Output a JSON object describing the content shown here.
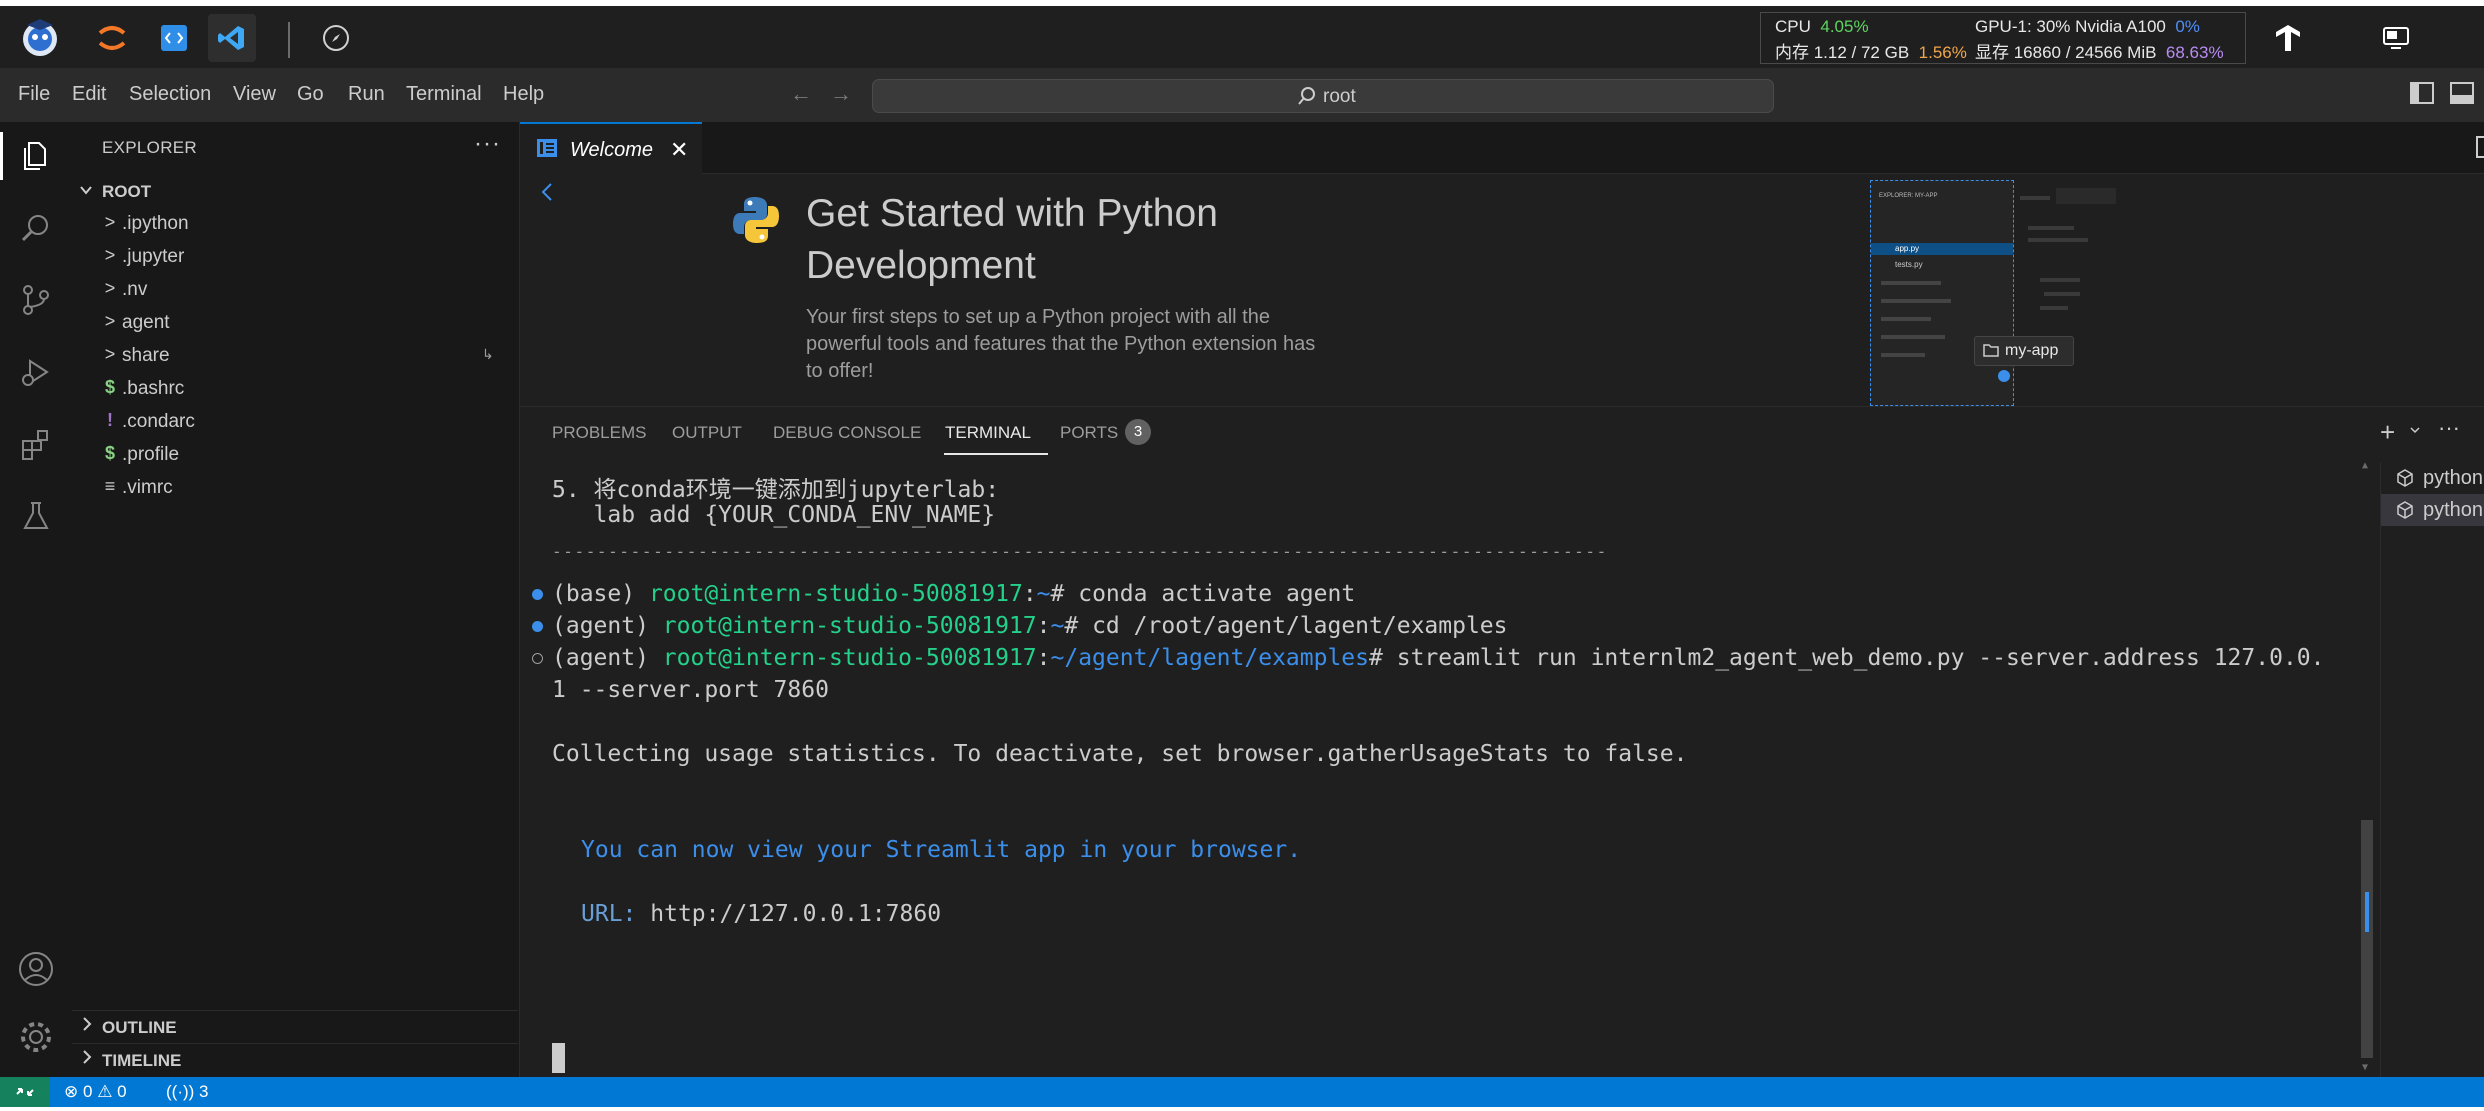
{
  "host_bar": {
    "apps": [
      {
        "name": "internstudio-logo-icon"
      },
      {
        "name": "jupyter-icon"
      },
      {
        "name": "code-brackets-icon"
      },
      {
        "name": "vscode-icon"
      },
      {
        "name": "compass-icon"
      }
    ],
    "stats": {
      "cpu_label": "CPU",
      "cpu_value": "4.05%",
      "mem_label": "内存 1.12 / 72 GB",
      "mem_value": "1.56%",
      "gpu_label": "GPU-1: 30% Nvidia A100",
      "gpu_value": "0%",
      "vram_label": "显存 16860 / 24566 MiB",
      "vram_value": "68.63%"
    }
  },
  "menubar": {
    "items": [
      "File",
      "Edit",
      "Selection",
      "View",
      "Go",
      "Run",
      "Terminal",
      "Help"
    ],
    "search_text": "root"
  },
  "activity_bar": {
    "items": [
      "explorer-icon",
      "search-icon",
      "source-control-icon",
      "run-debug-icon",
      "extensions-icon",
      "testing-icon"
    ],
    "bottom": [
      "account-icon",
      "settings-gear-icon"
    ]
  },
  "explorer": {
    "title": "EXPLORER",
    "root_label": "ROOT",
    "items": [
      {
        "label": ".ipython",
        "icon": ">",
        "kind": "folder"
      },
      {
        "label": ".jupyter",
        "icon": ">",
        "kind": "folder"
      },
      {
        "label": ".nv",
        "icon": ">",
        "kind": "folder"
      },
      {
        "label": "agent",
        "icon": ">",
        "kind": "folder"
      },
      {
        "label": "share",
        "icon": ">",
        "kind": "folder"
      },
      {
        "label": ".bashrc",
        "icon": "$",
        "kind": "shell"
      },
      {
        "label": ".condarc",
        "icon": "!",
        "kind": "yaml"
      },
      {
        "label": ".profile",
        "icon": "$",
        "kind": "shell"
      },
      {
        "label": ".vimrc",
        "icon": "≡",
        "kind": "text"
      }
    ],
    "outline_label": "OUTLINE",
    "timeline_label": "TIMELINE"
  },
  "editor": {
    "tab_label": "Welcome",
    "welcome": {
      "title_line1": "Get Started with Python",
      "title_line2": "Development",
      "description": "Your first steps to set up a Python project with all the powerful tools and features that the Python extension has to offer!",
      "preview": {
        "header": "EXPLORER: MY-APP",
        "files": [
          "app.py",
          "tests.py"
        ],
        "folder_badge": "my-app"
      }
    }
  },
  "panel": {
    "tabs": [
      "PROBLEMS",
      "OUTPUT",
      "DEBUG CONSOLE",
      "TERMINAL",
      "PORTS"
    ],
    "active_tab": "TERMINAL",
    "ports_count": "3",
    "terminal": {
      "conda_step": "5. 将conda环境一键添加到jupyterlab:",
      "conda_cmd": "   lab add {YOUR_CONDA_ENV_NAME}",
      "separator": "----------------------------------------------------------------------------------------------",
      "cmd1": {
        "env": "(base) ",
        "host": "root@intern-studio-50081917",
        "colon": ":",
        "path": "~",
        "prompt": "# ",
        "command": "conda activate agent"
      },
      "cmd2": {
        "env": "(agent) ",
        "host": "root@intern-studio-50081917",
        "colon": ":",
        "path": "~",
        "prompt": "# ",
        "command": "cd /root/agent/lagent/examples"
      },
      "cmd3": {
        "env": "(agent) ",
        "host": "root@intern-studio-50081917",
        "colon": ":",
        "path": "~/agent/lagent/examples",
        "prompt": "# ",
        "command": "streamlit run internlm2_agent_web_demo.py --server.address 127.0.0.",
        "command_wrap": "1 --server.port 7860"
      },
      "stats_msg": "Collecting usage statistics. To deactivate, set browser.gatherUsageStats to false.",
      "view_msg": "You can now view your Streamlit app in your browser.",
      "url_label": "URL: ",
      "url_value": "http://127.0.0.1:7860"
    },
    "terminal_list": [
      "python",
      "python"
    ]
  },
  "statusbar": {
    "errors": "0",
    "warnings": "0",
    "ports": "3"
  },
  "colors": {
    "accent": "#0078d4",
    "remote": "#16825d",
    "terminal_green": "#23d18b",
    "terminal_blue": "#3b8eea",
    "cpu_green": "#5fd35f",
    "mem_orange": "#f0a64a",
    "vram_violet": "#b88cf2"
  }
}
